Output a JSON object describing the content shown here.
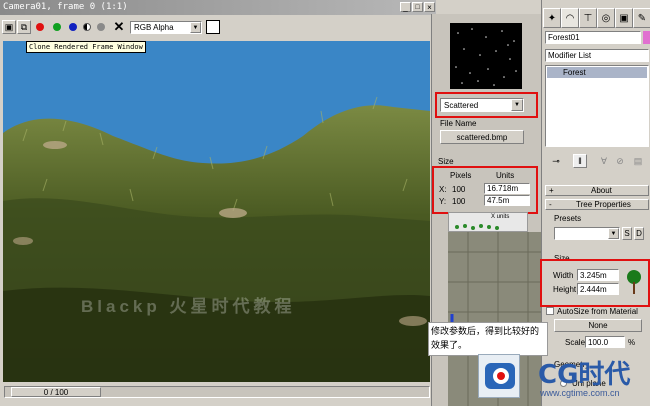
{
  "render_window": {
    "title": "Camera01, frame 0 (1:1)",
    "channel_select": "RGB Alpha",
    "tooltip": "Clone Rendered Frame Window",
    "watermark": "Blackp 火星时代教程",
    "frame_counter": "0 / 100"
  },
  "bitmap_panel": {
    "dropdown_value": "Scattered",
    "file_name_label": "File Name",
    "file_name_value": "scattered.bmp",
    "size_group": "Size",
    "pixels_header": "Pixels",
    "units_header": "Units",
    "x_label": "X:",
    "x_pixels": "100",
    "x_units": "16.718m",
    "y_label": "Y:",
    "y_pixels": "100",
    "y_units": "47.5m",
    "preview_label": "X units"
  },
  "caption": "修改参数后，得到比较好的效果了。",
  "command_panel": {
    "object_name": "Forest01",
    "modifier_list": "Modifier List",
    "stack_item": "Forest",
    "about": "About",
    "tree_properties": "Tree Properties",
    "presets_label": "Presets",
    "preset_s": "S",
    "preset_d": "D",
    "size_group": "Size",
    "width_label": "Width",
    "width_value": "3.245m",
    "height_label": "Height",
    "height_value": "2.444m",
    "autosize": "AutoSize from Material",
    "none_button": "None",
    "scale_label": "Scale",
    "scale_value": "100.0",
    "scale_unit": "%",
    "geometry": "Geometry",
    "uni_plane": "Uni plane"
  },
  "logo": {
    "brand": "CG时代",
    "url": "www.cgtime.com.cn"
  },
  "colors": {
    "sky": "#3a86c6",
    "highlight": "#e01010",
    "selection": "#0a246a"
  }
}
